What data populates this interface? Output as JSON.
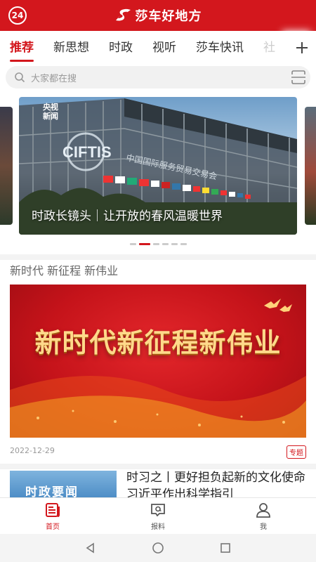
{
  "header": {
    "badge": "24",
    "app_name": "莎车好地方",
    "brand_color": "#d3171d"
  },
  "tabs": [
    {
      "label": "推荐",
      "active": true
    },
    {
      "label": "新思想"
    },
    {
      "label": "时政"
    },
    {
      "label": "视听"
    },
    {
      "label": "莎车快讯"
    },
    {
      "label": "社"
    }
  ],
  "search": {
    "placeholder": "大家都在搜"
  },
  "carousel": {
    "source_logo_line1": "央视",
    "source_logo_line2": "新闻",
    "building_text": "CIFTIS",
    "caption": "时政长镜头｜让开放的春风温暖世界",
    "slide_count": 6,
    "active_index": 1
  },
  "topic": {
    "title": "新时代 新征程 新伟业",
    "banner_text": "新时代新征程新伟业",
    "date": "2022-12-29",
    "tag": "专题"
  },
  "news": {
    "thumb_text": "时政要闻",
    "title": "时习之丨更好担负起新的文化使命 习近平作出科学指引"
  },
  "bottom_nav": [
    {
      "label": "首页",
      "icon": "home-news-icon",
      "active": true
    },
    {
      "label": "报料",
      "icon": "chat-report-icon"
    },
    {
      "label": "我",
      "icon": "person-icon"
    }
  ],
  "system_nav": [
    "back-icon",
    "home-circle-icon",
    "recents-square-icon"
  ]
}
